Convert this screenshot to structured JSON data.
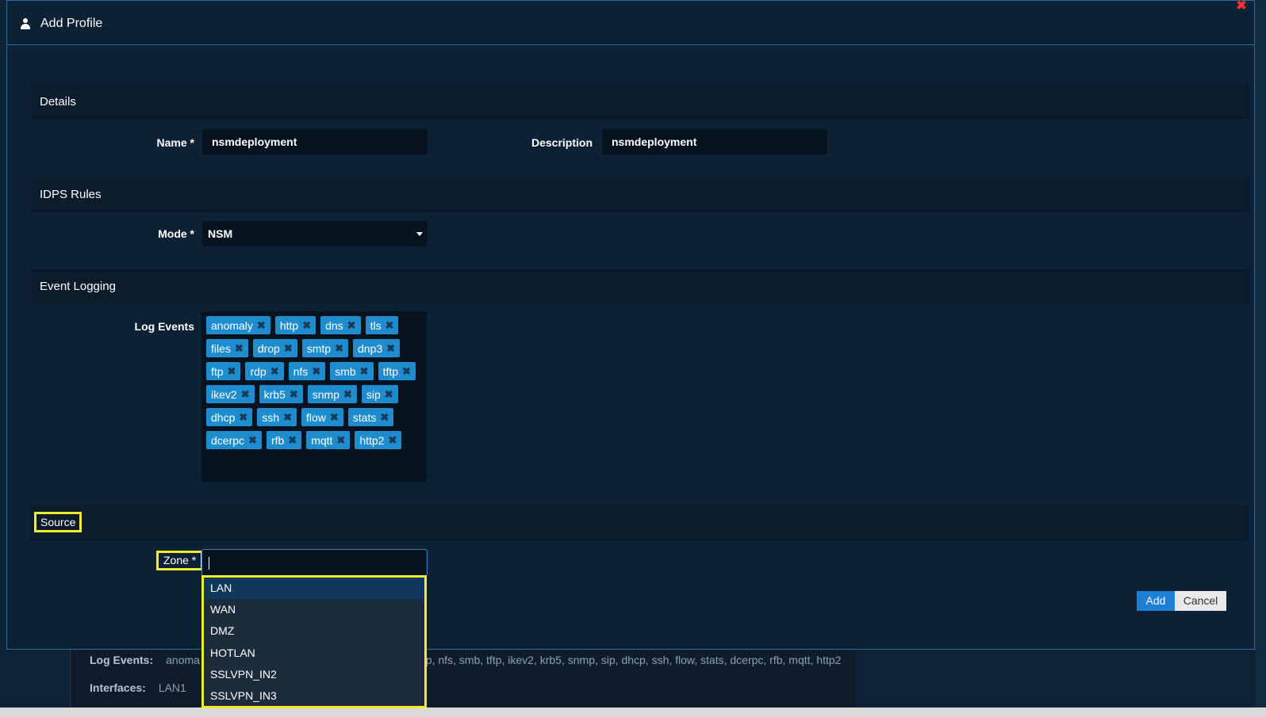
{
  "modal": {
    "title": "Add Profile",
    "close_glyph": "✖"
  },
  "sections": {
    "details": "Details",
    "idps_rules": "IDPS Rules",
    "event_logging": "Event Logging",
    "source": "Source"
  },
  "details": {
    "name_label": "Name *",
    "name_value": "nsmdeployment",
    "description_label": "Description",
    "description_value": "nsmdeployment"
  },
  "idps": {
    "mode_label": "Mode *",
    "mode_value": "NSM"
  },
  "logging": {
    "log_events_label": "Log Events",
    "tag_rows": [
      [
        "anomaly",
        "http",
        "dns",
        "tls"
      ],
      [
        "files",
        "drop",
        "smtp",
        "dnp3"
      ],
      [
        "ftp",
        "rdp",
        "nfs",
        "smb",
        "tftp"
      ],
      [
        "ikev2",
        "krb5",
        "snmp",
        "sip"
      ],
      [
        "dhcp",
        "ssh",
        "flow",
        "stats"
      ],
      [
        "dcerpc",
        "rfb",
        "mqtt",
        "http2"
      ]
    ]
  },
  "source": {
    "zone_label": "Zone *",
    "zone_value": "",
    "zone_options": [
      "LAN",
      "WAN",
      "DMZ",
      "HOTLAN",
      "SSLVPN_IN2",
      "SSLVPN_IN3"
    ]
  },
  "footer": {
    "add_label": "Add",
    "cancel_label": "Cancel"
  },
  "background": {
    "log_events_label": "Log Events:",
    "log_events_value": "anoma",
    "log_events_tail": "dp, nfs, smb, tftp, ikev2, krb5, snmp, sip, dhcp, ssh, flow, stats, dcerpc, rfb, mqtt, http2",
    "interfaces_label": "Interfaces:",
    "interfaces_value": "LAN1"
  },
  "colors": {
    "accent": "#1f7fd5",
    "tag": "#1e8ccd",
    "highlight": "#f2ec2a",
    "close": "#e33333"
  },
  "icons": {
    "user": "user-icon",
    "close": "close-icon",
    "remove": "remove-tag-icon",
    "caret": "caret-down-icon"
  }
}
